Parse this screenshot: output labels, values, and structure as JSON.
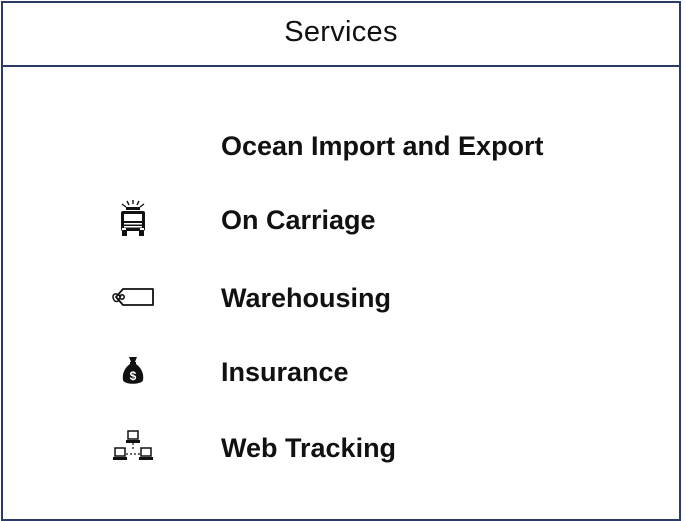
{
  "panel": {
    "title": "Services"
  },
  "services": [
    {
      "label": "Ocean Import and Export",
      "icon": ""
    },
    {
      "label": "On Carriage",
      "icon": "fire-truck-icon"
    },
    {
      "label": "Warehousing",
      "icon": "tag-icon"
    },
    {
      "label": "Insurance",
      "icon": "money-bag-icon"
    },
    {
      "label": "Web Tracking",
      "icon": "network-icon"
    }
  ]
}
